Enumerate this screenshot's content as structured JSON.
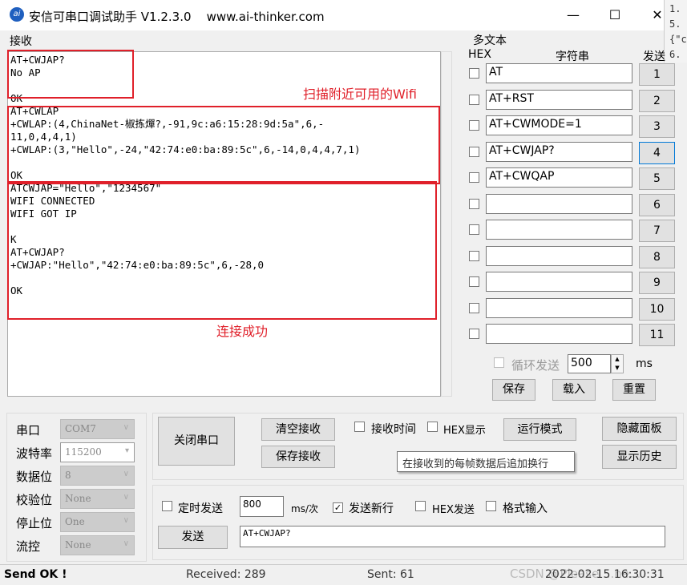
{
  "window": {
    "title": "安信可串口调试助手 V1.2.3.0    www.ai-thinker.com",
    "icon": "ai-thinker-logo",
    "minimize": "—",
    "maximize": "☐",
    "close": "✕"
  },
  "side_snippet": "1.\n5.\n{\"c\n6.",
  "receive": {
    "label": "接收",
    "text": "AT+CWJAP?\nNo AP\n\nOK\nAT+CWLAP\n+CWLAP:(4,ChinaNet-椒拣燀?,-91,9c:a6:15:28:9d:5a\",6,-\n11,0,4,4,1)\n+CWLAP:(3,\"Hello\",-24,\"42:74:e0:ba:89:5c\",6,-14,0,4,4,7,1)\n\nOK\nATCWJAP=\"Hello\",\"1234567\"\nWIFI CONNECTED\nWIFI GOT IP\n\nK\nAT+CWJAP?\n+CWJAP:\"Hello\",\"42:74:e0:ba:89:5c\",6,-28,0\n\nOK"
  },
  "annotations": {
    "scan": "扫描附近可用的Wifi",
    "connected": "连接成功",
    "color": "#e0202a"
  },
  "multi": {
    "label": "多文本",
    "hex_header": "HEX",
    "string_header": "字符串",
    "send_header": "发送",
    "rows": [
      {
        "value": "AT",
        "btn": "1"
      },
      {
        "value": "AT+RST",
        "btn": "2"
      },
      {
        "value": "AT+CWMODE=1",
        "btn": "3"
      },
      {
        "value": "AT+CWJAP?",
        "btn": "4"
      },
      {
        "value": "AT+CWQAP",
        "btn": "5"
      },
      {
        "value": "",
        "btn": "6"
      },
      {
        "value": "",
        "btn": "7"
      },
      {
        "value": "",
        "btn": "8"
      },
      {
        "value": "",
        "btn": "9"
      },
      {
        "value": "",
        "btn": "10"
      },
      {
        "value": "",
        "btn": "11"
      }
    ],
    "loop_label": "循环发送",
    "loop_interval": "500",
    "ms": "ms",
    "save": "保存",
    "load": "载入",
    "reset": "重置"
  },
  "port": {
    "port_label": "串口",
    "port": "COM7",
    "baud_label": "波特率",
    "baud": "115200",
    "data_label": "数据位",
    "data": "8",
    "parity_label": "校验位",
    "parity": "None",
    "stop_label": "停止位",
    "stop": "One",
    "flow_label": "流控",
    "flow": "None"
  },
  "controls": {
    "close_port": "关闭串口",
    "clear_recv": "清空接收",
    "save_recv": "保存接收",
    "recv_time": "接收时间",
    "hex_display": "HEX显示",
    "run_mode": "运行模式",
    "hide_panel": "隐藏面板",
    "show_history": "显示历史",
    "tooltip": "在接收到的每帧数据后追加换行"
  },
  "send": {
    "timed_send": "定时发送",
    "interval": "800",
    "unit": "ms/次",
    "newline": "发送新行",
    "hex_send": "HEX发送",
    "format_input": "格式输入",
    "send_btn": "发送",
    "input": "AT+CWJAP?"
  },
  "status": {
    "message": "Send OK !",
    "received": "Received: 289",
    "sent": "Sent: 61",
    "time": "2022-02-15 16:30:31",
    "watermark": "CSDN @Please ...ne..."
  }
}
